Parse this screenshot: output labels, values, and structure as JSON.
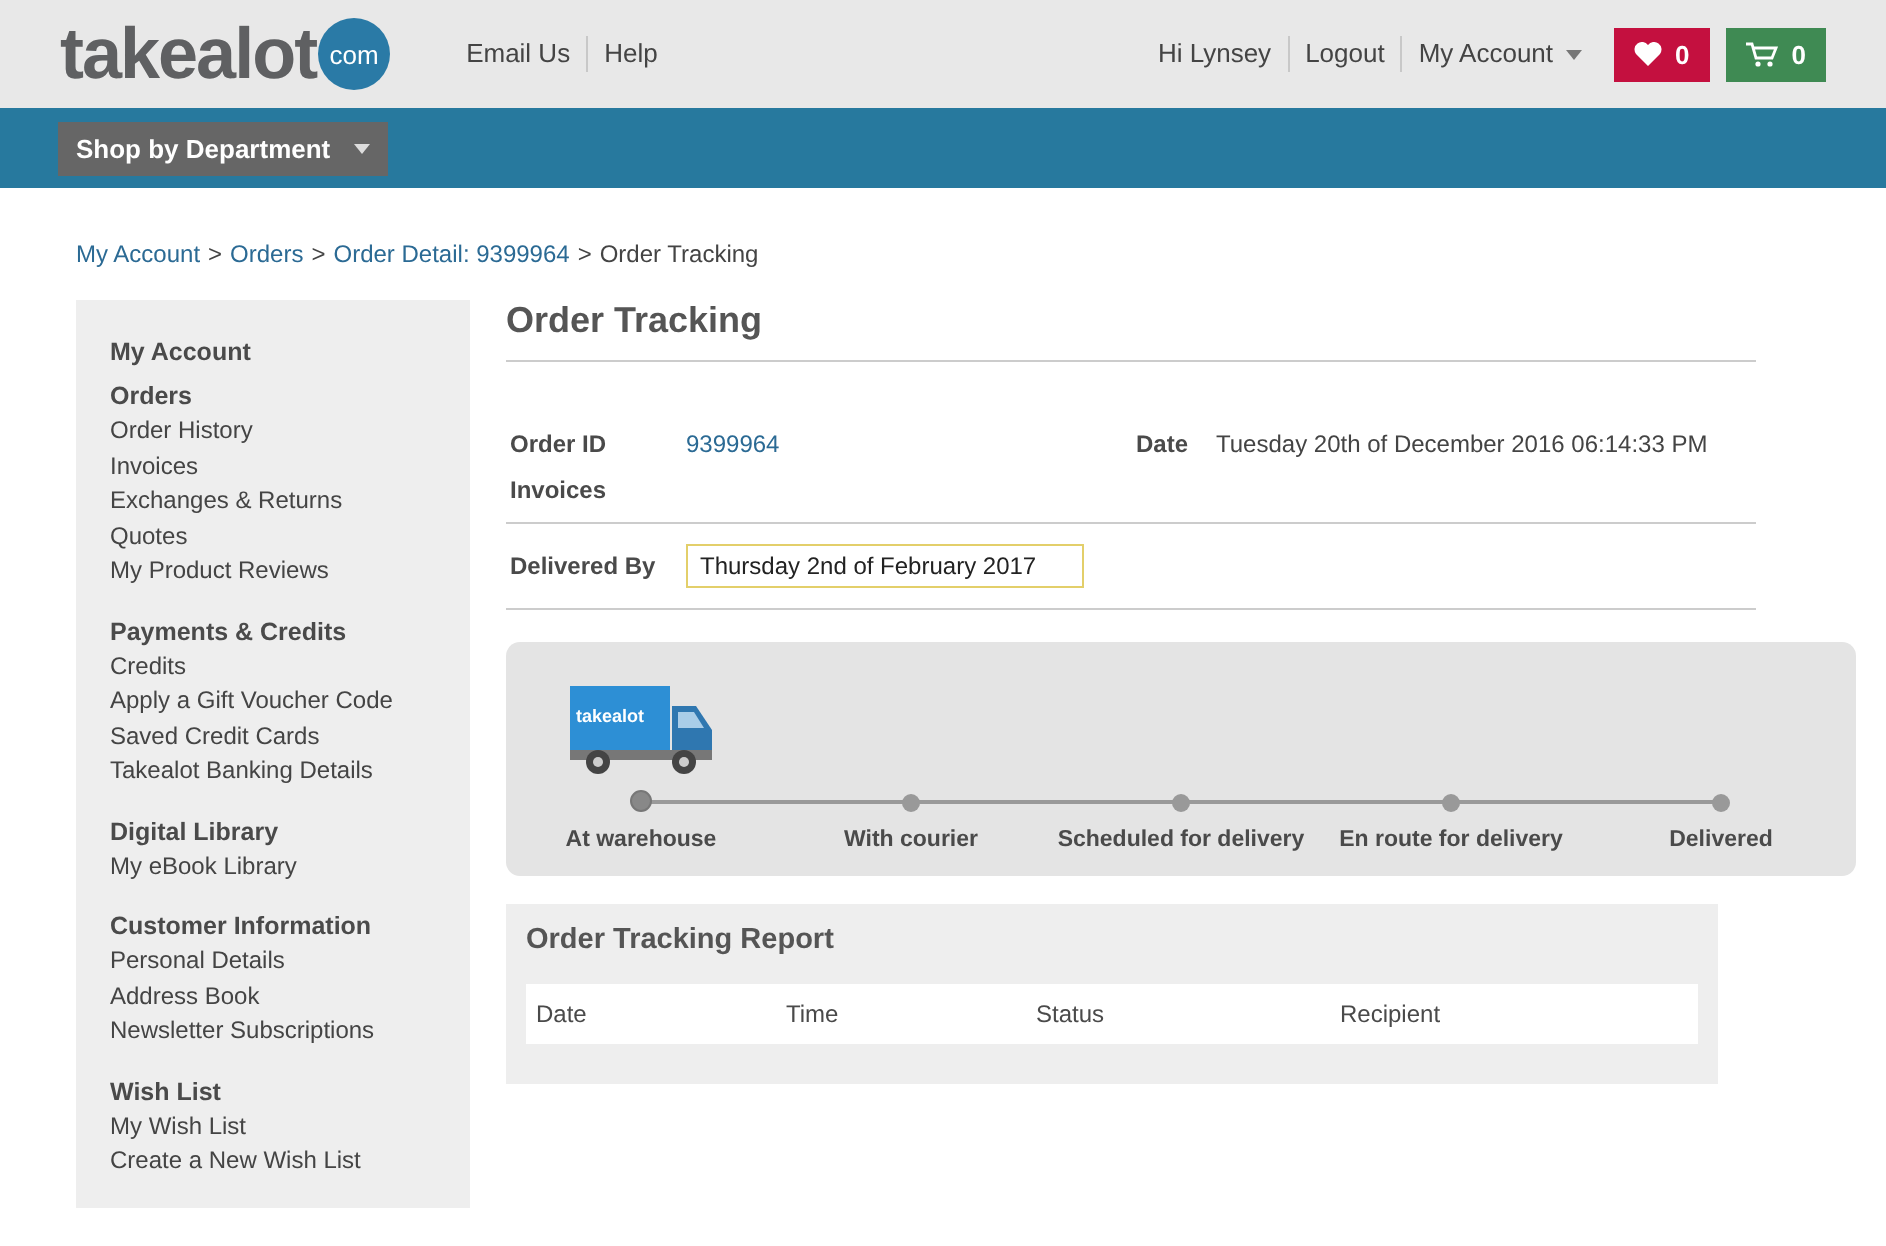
{
  "header": {
    "logo": {
      "word": "takealot",
      "badge": "com"
    },
    "links": [
      "Email Us",
      "Help"
    ],
    "user_links": [
      "Hi Lynsey",
      "Logout"
    ],
    "account_menu": "My Account",
    "wishlist_count": "0",
    "cart_count": "0"
  },
  "nav": {
    "department_button": "Shop by Department"
  },
  "breadcrumb_separator": ">",
  "breadcrumb": [
    {
      "label": "My Account",
      "link": true
    },
    {
      "label": "Orders",
      "link": true
    },
    {
      "label": "Order Detail: 9399964",
      "link": true
    },
    {
      "label": "Order Tracking",
      "link": false
    }
  ],
  "sidebar_title": "My Account",
  "sidebar": [
    {
      "heading": "Orders",
      "items": [
        "Order History",
        "Invoices",
        "Exchanges & Returns",
        "Quotes",
        "My Product Reviews"
      ]
    },
    {
      "heading": "Payments & Credits",
      "items": [
        "Credits",
        "Apply a Gift Voucher Code",
        "Saved Credit Cards",
        "Takealot Banking Details"
      ]
    },
    {
      "heading": "Digital Library",
      "items": [
        "My eBook Library"
      ]
    },
    {
      "heading": "Customer Information",
      "items": [
        "Personal Details",
        "Address Book",
        "Newsletter Subscriptions"
      ]
    },
    {
      "heading": "Wish List",
      "items": [
        "My Wish List",
        "Create a New Wish List"
      ]
    }
  ],
  "page_title": "Order Tracking",
  "order": {
    "id_label": "Order ID",
    "id": "9399964",
    "date_label": "Date",
    "date": "Tuesday 20th of December 2016 06:14:33 PM",
    "invoices_label": "Invoices",
    "delivered_label": "Delivered By",
    "delivered": "Thursday 2nd of February 2017"
  },
  "tracker": {
    "truck_label": "takealot",
    "steps": [
      {
        "label": "At warehouse",
        "selected": true
      },
      {
        "label": "With courier",
        "selected": false
      },
      {
        "label": "Scheduled for delivery",
        "selected": false
      },
      {
        "label": "En route for delivery",
        "selected": false
      },
      {
        "label": "Delivered",
        "selected": false
      }
    ]
  },
  "report": {
    "title": "Order Tracking Report",
    "columns": [
      "Date",
      "Time",
      "Status",
      "Recipient"
    ]
  }
}
